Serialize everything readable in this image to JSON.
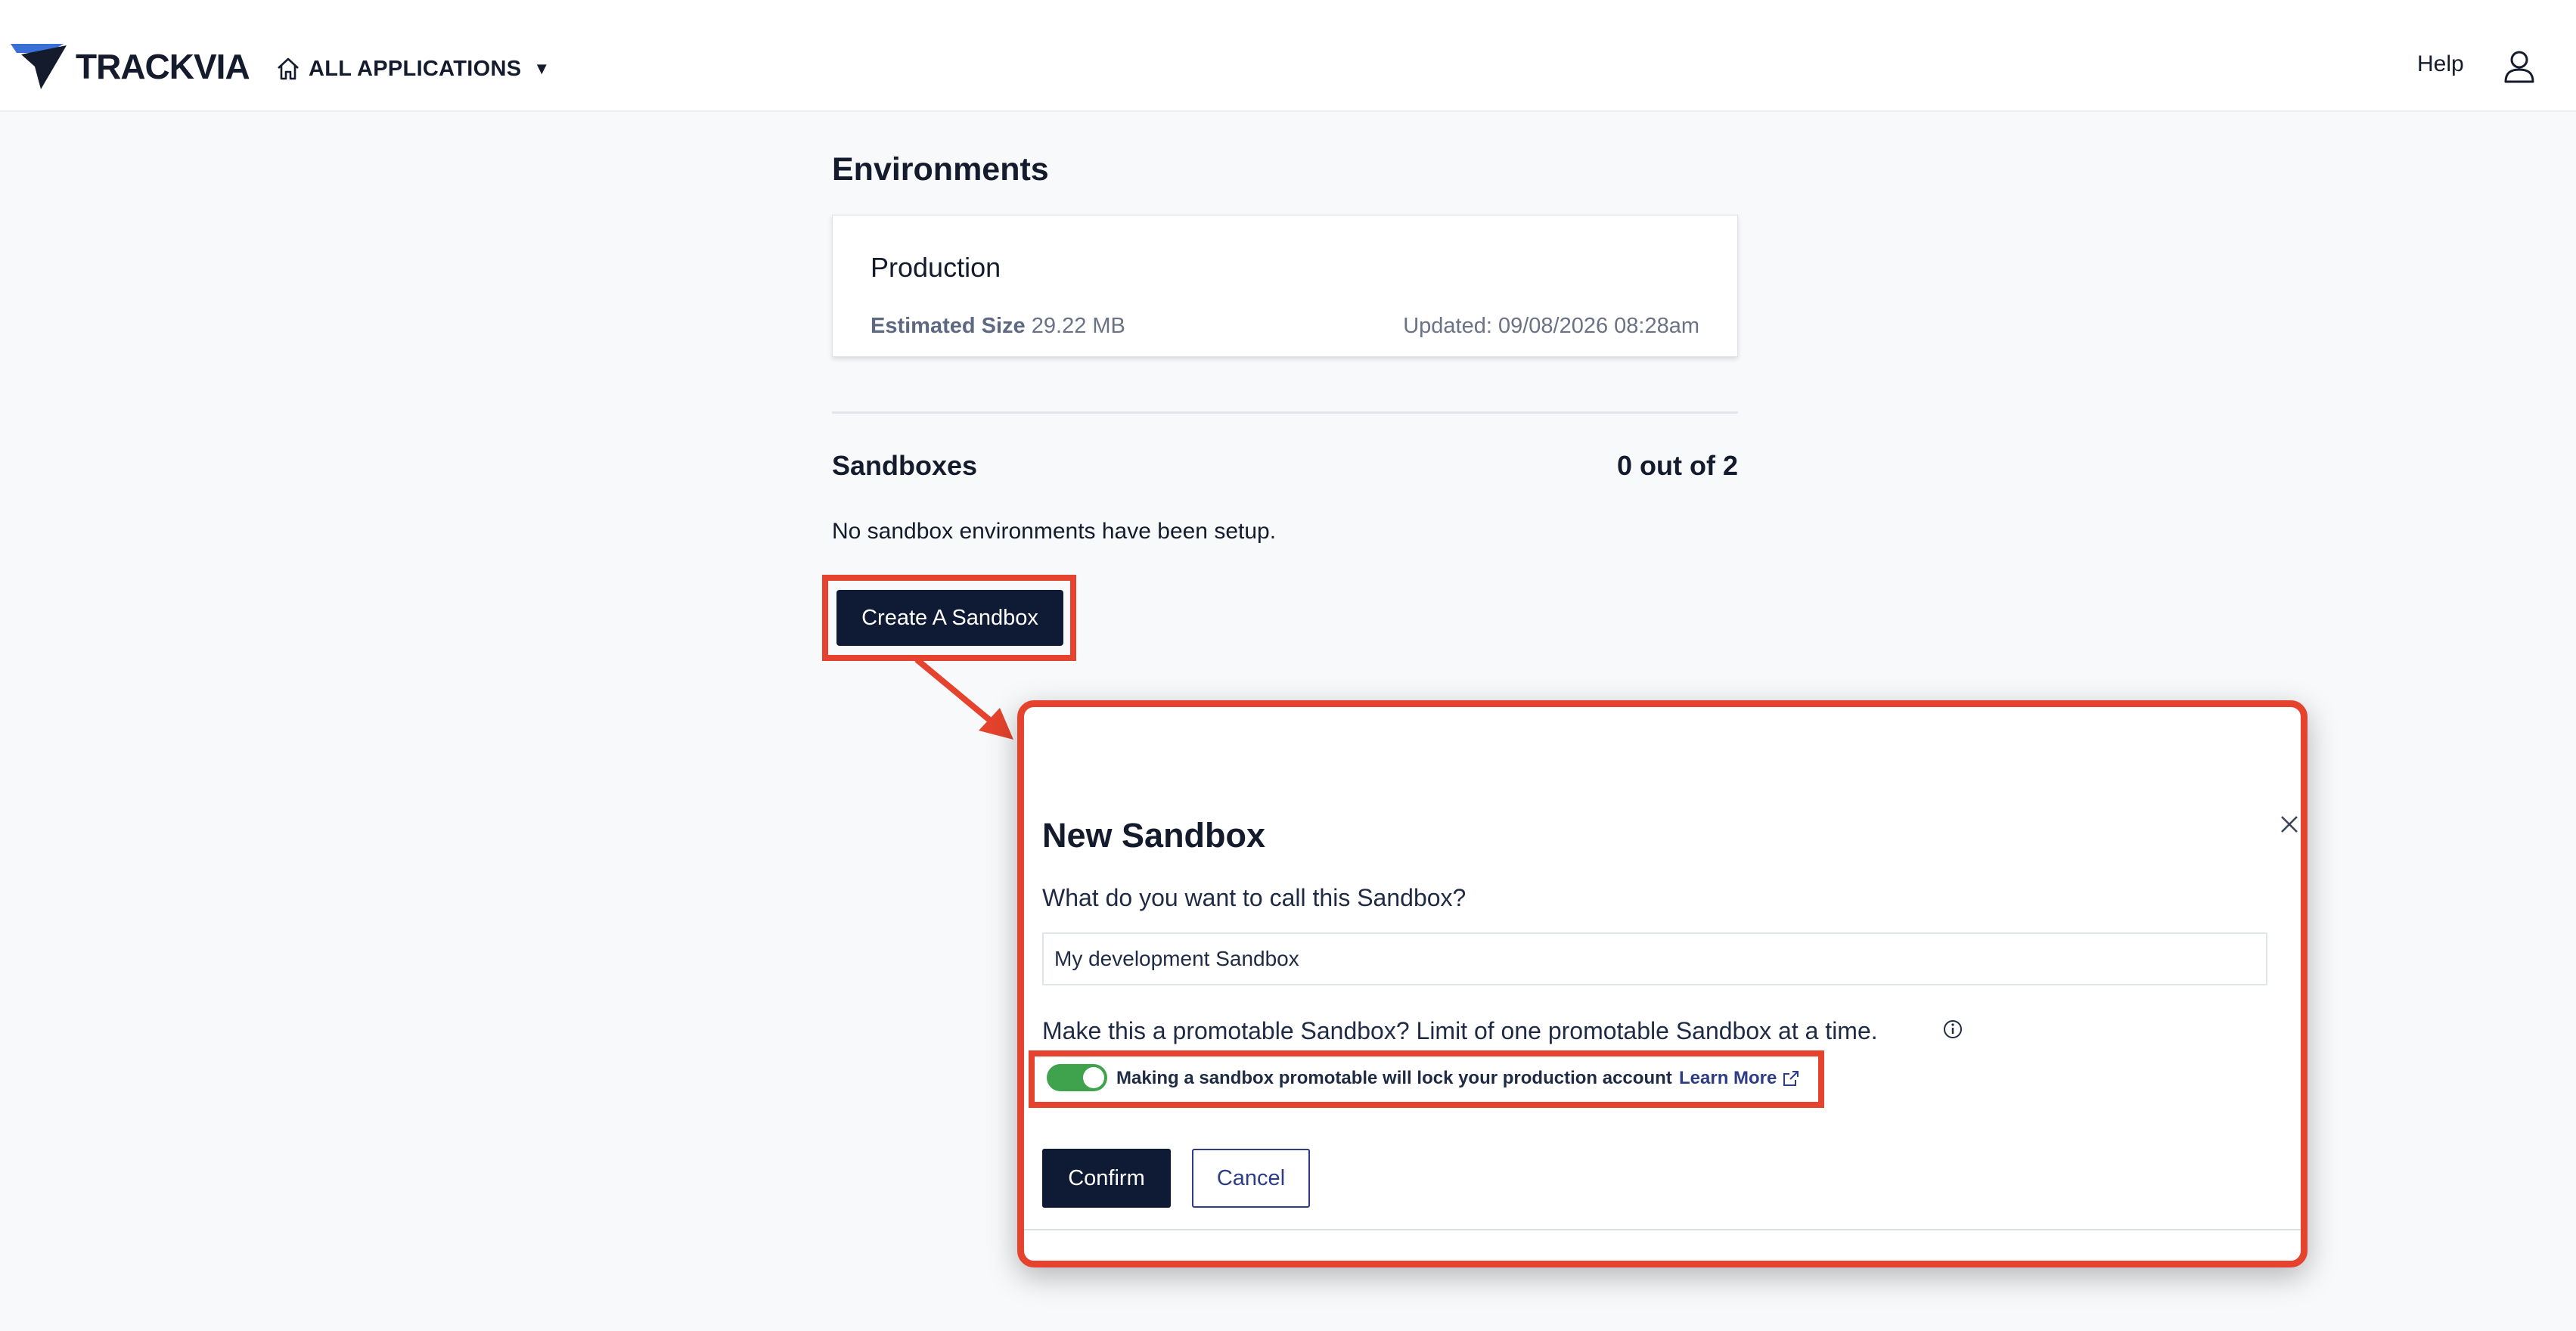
{
  "header": {
    "logo_text": "TRACKVIA",
    "apps_label": "ALL APPLICATIONS",
    "apps_caret": "▼",
    "help_label": "Help",
    "icons": [
      "home-icon",
      "user-icon"
    ]
  },
  "environments": {
    "title": "Environments",
    "production": {
      "name": "Production",
      "size_label": "Estimated Size",
      "size_value": "29.22 MB",
      "updated": "Updated: 09/08/2026 08:28am"
    }
  },
  "sandboxes": {
    "title": "Sandboxes",
    "count": "0 out of 2",
    "empty_text": "No sandbox environments have been setup.",
    "create_label": "Create A Sandbox"
  },
  "modal": {
    "title": "New Sandbox",
    "name_question": "What do you want to call this Sandbox?",
    "name_value": "My development Sandbox",
    "promotable_question": "Make this a promotable Sandbox? Limit of one promotable Sandbox at a time.",
    "toggle_on": true,
    "toggle_text": "Making a sandbox promotable will lock your production account",
    "learn_more": "Learn More",
    "confirm_label": "Confirm",
    "cancel_label": "Cancel"
  },
  "colors": {
    "highlight": "#e5432d",
    "primary_button": "#0f1b35",
    "toggle_on": "#3fa34d",
    "link": "#2c3c88",
    "logo_blue": "#3b6fd8"
  }
}
